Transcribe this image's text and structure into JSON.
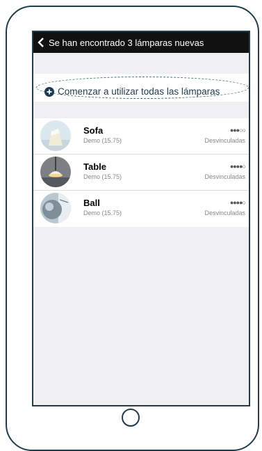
{
  "navbar": {
    "title": "Se han encontrado 3 lámparas nuevas",
    "back_icon": "chevron-left-icon"
  },
  "start_all": {
    "label": "Comenzar a utilizar todas las lámparas",
    "icon": "plus-circle-icon"
  },
  "lamps": [
    {
      "name": "Sofa",
      "subtitle": "Demo (15.75)",
      "dots": "●●●○○",
      "status": "Desvinculadas"
    },
    {
      "name": "Table",
      "subtitle": "Demo (15.75)",
      "dots": "●●●●○",
      "status": "Desvinculadas"
    },
    {
      "name": "Ball",
      "subtitle": "Demo (15.75)",
      "dots": "●●●●○",
      "status": "Desvinculadas"
    }
  ],
  "colors": {
    "navbar": "#111111",
    "accent": "#1d3a52",
    "screen_bg": "#f0f0f2",
    "device_outline": "#1f3c4d"
  }
}
